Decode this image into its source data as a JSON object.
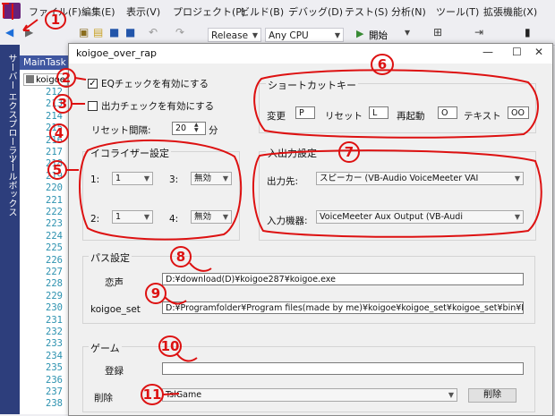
{
  "menubar": {
    "items": [
      "ファイル(F)",
      "編集(E)",
      "表示(V)",
      "プロジェクト(P)",
      "ビルド(B)",
      "デバッグ(D)",
      "テスト(S)",
      "分析(N)",
      "ツール(T)",
      "拡張機能(X)"
    ]
  },
  "toolbar": {
    "config": "Release",
    "platform": "Any CPU",
    "start_label": "開始"
  },
  "side_tabs": {
    "server_explorer": "サーバー エクスプローラー",
    "toolbox": "ツールボックス"
  },
  "editor": {
    "tab_label": "MainTask",
    "file_label": "koigoe",
    "line_numbers": [
      "212",
      "213",
      "214",
      "215",
      "216",
      "217",
      "218",
      "219",
      "220",
      "221",
      "222",
      "223",
      "224",
      "225",
      "226",
      "227",
      "228",
      "229",
      "230",
      "231",
      "232",
      "233",
      "234",
      "235",
      "236",
      "237",
      "238"
    ]
  },
  "form": {
    "title": "koigoe_over_rap",
    "eq_check_label": "EQチェックを有効にする",
    "out_check_label": "出力チェックを有効にする",
    "reset_interval_label": "リセット間隔:",
    "reset_interval_value": "20",
    "reset_interval_unit": "分",
    "eq_group": {
      "title": "イコライザー設定",
      "slot1_label": "1:",
      "slot1_value": "1",
      "slot2_label": "2:",
      "slot2_value": "1",
      "slot3_label": "3:",
      "slot3_value": "無効",
      "slot4_label": "4:",
      "slot4_value": "無効"
    },
    "shortcut_group": {
      "title": "ショートカットキー",
      "change_label": "変更",
      "change_value": "P",
      "reset_label": "リセット",
      "reset_value": "L",
      "restart_label": "再起動",
      "restart_value": "O",
      "text_label": "テキスト",
      "text_value": "OO"
    },
    "io_group": {
      "title": "入出力設定",
      "output_label": "出力先:",
      "output_value": "スピーカー (VB-Audio VoiceMeeter VAI",
      "input_label": "入力機器:",
      "input_value": "VoiceMeeter Aux Output (VB-Audi"
    },
    "path_group": {
      "title": "パス設定",
      "koigoe_label": "恋声",
      "koigoe_value": "D:¥download(D)¥koigoe287¥koigoe.exe",
      "koigoe_set_label": "koigoe_set",
      "koigoe_set_value": "D:¥Programfolder¥Program files(made by me)¥koigoe¥koigoe_set¥koigoe_set¥bin¥R"
    },
    "game_group": {
      "title": "ゲーム",
      "register_label": "登録",
      "register_value": "",
      "delete_label": "削除",
      "delete_value": "TslGame",
      "delete_button": "削除"
    }
  },
  "annotations": [
    "1",
    "2",
    "3",
    "4",
    "5",
    "6",
    "7",
    "8",
    "9",
    "10",
    "11"
  ],
  "colors": {
    "annotation": "#dd1111",
    "side_tab_bg": "#2d3e7c",
    "line_number": "#2b91af"
  }
}
